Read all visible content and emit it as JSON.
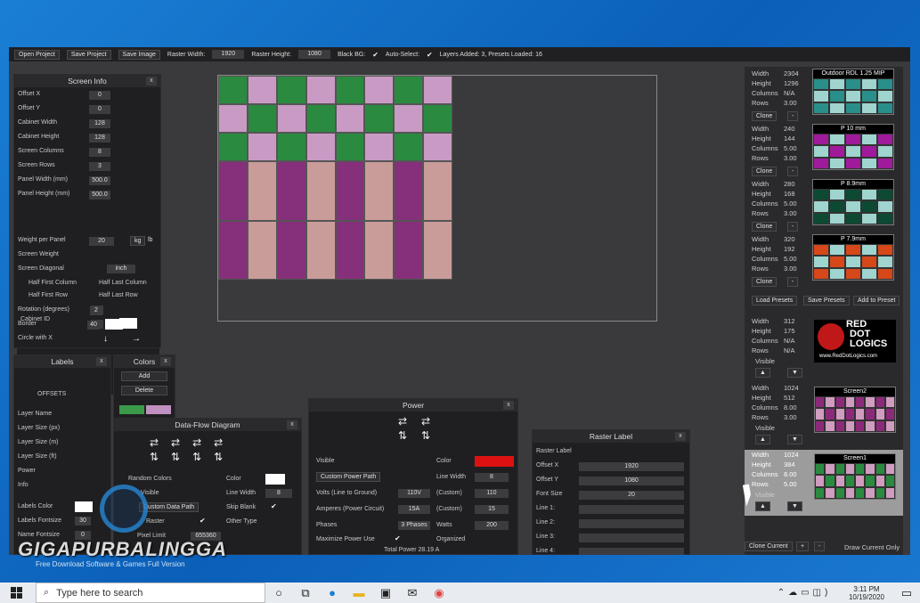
{
  "toolbar": {
    "open": "Open Project",
    "save": "Save Project",
    "save_image": "Save Image",
    "raster_width_label": "Raster Width:",
    "raster_width": "1920",
    "raster_height_label": "Raster Height:",
    "raster_height": "1080",
    "black_bg_label": "Black BG:",
    "auto_select_label": "Auto-Select:",
    "status": "Layers Added: 3, Presets Loaded: 16"
  },
  "screen_info": {
    "title": "Screen Info",
    "rows": [
      {
        "label": "Offset X",
        "value": "0"
      },
      {
        "label": "Offset Y",
        "value": "0"
      },
      {
        "label": "Cabinet Width",
        "value": "128"
      },
      {
        "label": "Cabinet Height",
        "value": "128"
      },
      {
        "label": "Screen Columns",
        "value": "8"
      },
      {
        "label": "Screen Rows",
        "value": "3"
      },
      {
        "label": "Panel Width  (mm)",
        "value": "500.0"
      },
      {
        "label": "Panel Height (mm)",
        "value": "500.0"
      }
    ],
    "weight_label": "Weight per Panel",
    "weight": "20",
    "weight_unit": "kg",
    "weight_unit2": "lb",
    "screen_weight": "Screen Weight",
    "diagonal": "Screen Diagonal",
    "diagonal_unit": "inch",
    "half_first_col": "Half First Column",
    "half_last_col": "Half Last Column",
    "half_first_row": "Half First Row",
    "half_last_row": "Half Last Row",
    "rotation": "Rotation (degrees)",
    "rotation_val": "0",
    "border": "Border",
    "border_val": "2",
    "circle": "Circle with X",
    "circle_val": "2",
    "cabinet_id": "Cabinet ID",
    "cabinet_id_val": "40"
  },
  "labels": {
    "title": "Labels",
    "offsets": "OFFSETS",
    "items": [
      "Layer Name",
      "Layer Size (px)",
      "Layer Size (m)",
      "Layer Size (ft)",
      "Power",
      "Info"
    ],
    "labels_color": "Labels Color",
    "fontsize_label": "Labels Fontsize",
    "fontsize": "30",
    "name_fontsize_label": "Name Fontsize",
    "name_fontsize": "0"
  },
  "colors": {
    "title": "Colors",
    "add": "Add",
    "delete": "Delete",
    "c1": "#3a9a4a",
    "c2": "#c090c0"
  },
  "dataflow": {
    "title": "Data-Flow Diagram",
    "random_colors": "Random Colors",
    "visible": "Visible",
    "custom_data_path": "Custom Data Path",
    "raster": "Raster",
    "pixel_limit_label": "Pixel Limit",
    "pixel_limit": "655360",
    "color": "Color",
    "line_width_label": "Line Width",
    "line_width": "8",
    "skip_blank": "Skip Blank",
    "other_type": "Other Type"
  },
  "power": {
    "title": "Power",
    "visible": "Visible",
    "color": "Color",
    "custom_power_path": "Custom Power Path",
    "line_width_label": "Line Width",
    "line_width": "8",
    "volts_label": "Volts (Line to Ground)",
    "volts": "110V",
    "volts_custom_label": "(Custom)",
    "volts_custom": "110",
    "amps_label": "Amperes (Power Circuit)",
    "amps": "15A",
    "amps_custom_label": "(Custom)",
    "amps_custom": "15",
    "phases_label": "Phases",
    "phases": "3 Phases",
    "watts_label": "Watts",
    "watts": "200",
    "max_power": "Maximize Power Use",
    "organized": "Organized",
    "total": "Total Power 28.19 A",
    "accent": "#dd1111"
  },
  "raster_label": {
    "title": "Raster Label",
    "rows": [
      {
        "label": "Raster Label",
        "value": ""
      },
      {
        "label": "Offset X",
        "value": "1920"
      },
      {
        "label": "Offset Y",
        "value": "1080"
      },
      {
        "label": "Font Size",
        "value": "20"
      },
      {
        "label": "Line 1:",
        "value": ""
      },
      {
        "label": "Line 2:",
        "value": ""
      },
      {
        "label": "Line 3:",
        "value": ""
      },
      {
        "label": "Line 4:",
        "value": ""
      }
    ]
  },
  "presets": [
    {
      "w": "2304",
      "h": "1296",
      "c": "N/A",
      "r": "3.00",
      "name": "Outdoor RDL 1.25 MIP",
      "clone": "Clone",
      "colors": [
        "#2a8f8a",
        "#9fd4cf"
      ]
    },
    {
      "w": "240",
      "h": "144",
      "c": "5.00",
      "r": "3.00",
      "name": "P 10 mm",
      "clone": "Clone",
      "colors": [
        "#a01a9c",
        "#9fd4cf"
      ]
    },
    {
      "w": "280",
      "h": "168",
      "c": "5.00",
      "r": "3.00",
      "name": "P 8.9mm",
      "clone": "Clone",
      "colors": [
        "#0c4a33",
        "#9fd4cf"
      ]
    },
    {
      "w": "320",
      "h": "192",
      "c": "5.00",
      "r": "3.00",
      "name": "P 7.9mm",
      "clone": "Clone",
      "colors": [
        "#d6471a",
        "#9fd4cf"
      ]
    }
  ],
  "preset_labels": {
    "width": "Width",
    "height": "Height",
    "columns": "Columns",
    "rows": "Rows",
    "load": "Load Presets",
    "save": "Save Presets",
    "add": "Add to Preset"
  },
  "layers": [
    {
      "w": "312",
      "h": "175",
      "c": "N/A",
      "r": "N/A",
      "name": "Logo",
      "visible": "Visible",
      "logo_line1": "RED",
      "logo_line2": "DOT",
      "logo_line3": "LOGICS",
      "logo_url": "www.RedDotLogics.com"
    },
    {
      "w": "1024",
      "h": "512",
      "c": "8.00",
      "r": "3.00",
      "name": "Screen2",
      "visible": "Visible",
      "colors": [
        "#8c2a7a",
        "#d09cbf"
      ]
    },
    {
      "w": "1024",
      "h": "384",
      "c": "8.00",
      "r": "5.00",
      "name": "Screen1",
      "visible": "Visible",
      "colors": [
        "#2a8a40",
        "#d09cbf"
      ]
    }
  ],
  "bottom": {
    "clone_current": "Clone Current",
    "plus": "+",
    "minus": "-",
    "draw_current": "Draw Current Only"
  },
  "watermark": {
    "title": "GIGAPURBALINGGA",
    "sub": "Free Download Software & Games Full Version"
  },
  "taskbar": {
    "search": "Type here to search",
    "time": "3:11 PM",
    "date": "10/19/2020"
  },
  "canvas": {
    "green": "#2a8a40",
    "pink": "#c99bc4",
    "purple": "#862f7b",
    "tan": "#c99c9a"
  }
}
